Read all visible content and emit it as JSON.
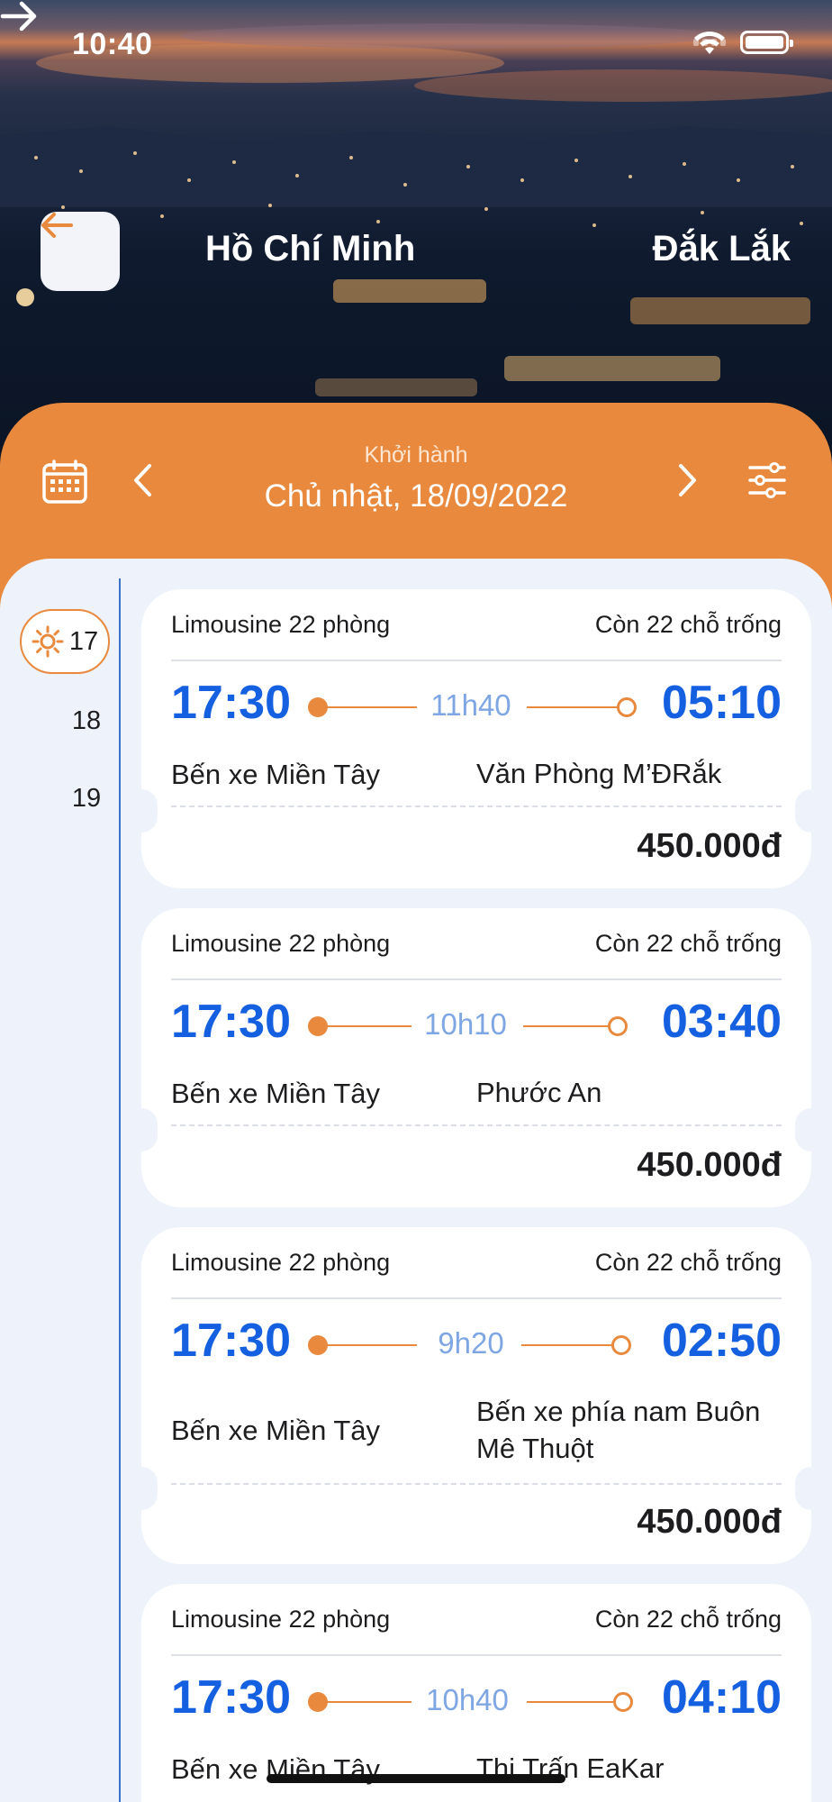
{
  "status_bar": {
    "time": "10:40"
  },
  "header": {
    "from": "Hồ Chí Minh",
    "to": "Đắk Lắk"
  },
  "date_bar": {
    "label": "Khởi hành",
    "date": "Chủ nhật, 18/09/2022"
  },
  "day_rail": {
    "selected": "17",
    "days": [
      "18",
      "19"
    ]
  },
  "trips": [
    {
      "vehicle": "Limousine 22 phòng",
      "seats": "Còn 22 chỗ trống",
      "departure": "17:30",
      "duration": "11h40",
      "arrival": "05:10",
      "from": "Bến xe Miền Tây",
      "to": "Văn Phòng M’ĐRắk",
      "price": "450.000đ"
    },
    {
      "vehicle": "Limousine 22 phòng",
      "seats": "Còn 22 chỗ trống",
      "departure": "17:30",
      "duration": "10h10",
      "arrival": "03:40",
      "from": "Bến xe Miền Tây",
      "to": "Phước An",
      "price": "450.000đ"
    },
    {
      "vehicle": "Limousine 22 phòng",
      "seats": "Còn 22 chỗ trống",
      "departure": "17:30",
      "duration": "9h20",
      "arrival": "02:50",
      "from": "Bến xe Miền Tây",
      "to": "Bến xe phía nam Buôn Mê Thuột",
      "price": "450.000đ"
    },
    {
      "vehicle": "Limousine 22 phòng",
      "seats": "Còn 22 chỗ trống",
      "departure": "17:30",
      "duration": "10h40",
      "arrival": "04:10",
      "from": "Bến xe Miền Tây",
      "to": "Thị Trấn EaKar"
    }
  ],
  "colors": {
    "accent": "#e8893e",
    "time_blue": "#1560e0",
    "duration_blue": "#7ea6e3",
    "background": "#eef2fa"
  }
}
